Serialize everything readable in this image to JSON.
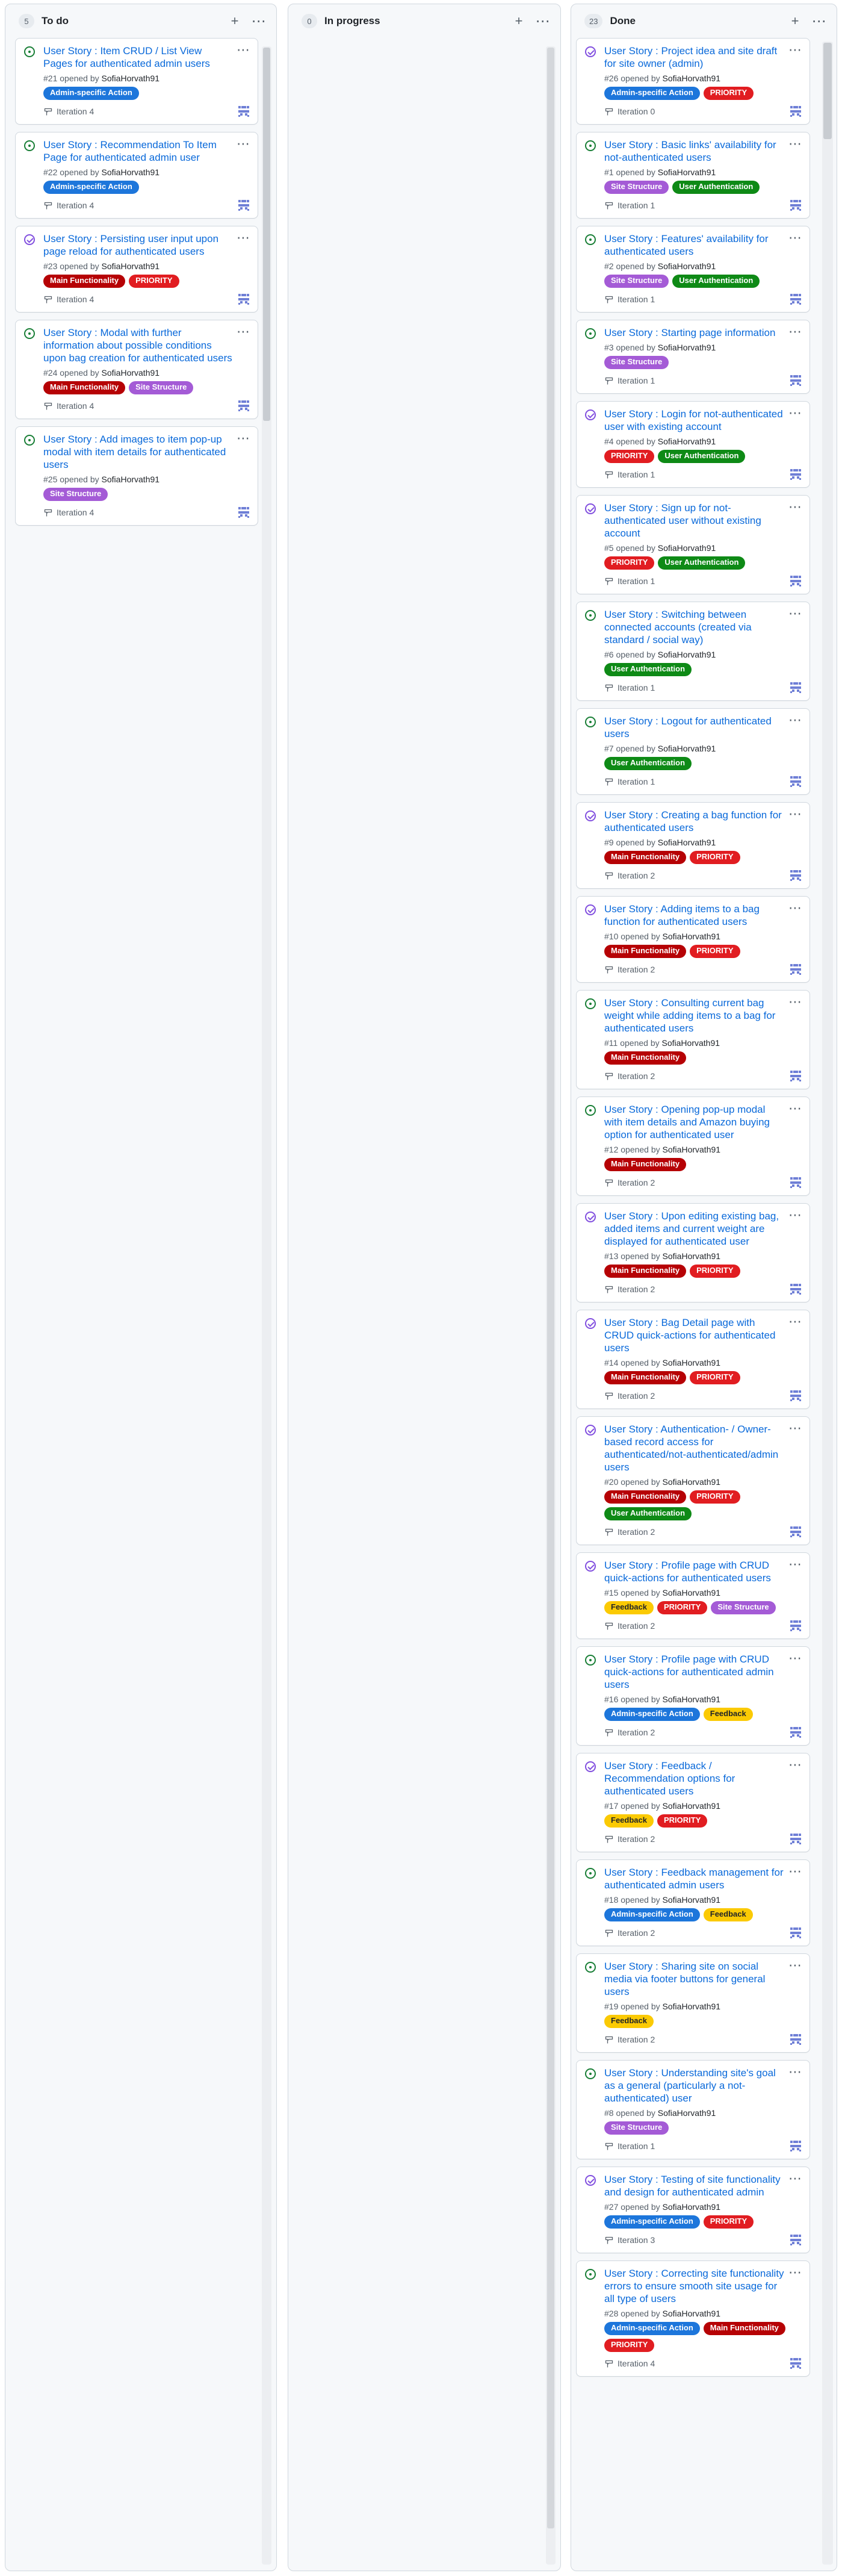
{
  "colors": {
    "open_icon": "#1a7f37",
    "closed_icon": "#8250df",
    "link": "#0969da"
  },
  "label_styles": {
    "Admin-specific Action": {
      "bg": "#1d76db",
      "fg": "#ffffff"
    },
    "PRIORITY": {
      "bg": "#e11d21",
      "fg": "#ffffff"
    },
    "Main Functionality": {
      "bg": "#b60205",
      "fg": "#ffffff"
    },
    "Site Structure": {
      "bg": "#a45bd6",
      "fg": "#ffffff"
    },
    "User Authentication": {
      "bg": "#0e8a16",
      "fg": "#ffffff"
    },
    "Feedback": {
      "bg": "#fbca04",
      "fg": "#1f2328"
    }
  },
  "columns": [
    {
      "id": "todo",
      "count": "5",
      "title": "To do",
      "cards": [
        {
          "status": "open",
          "title": "User Story : Item CRUD / List View Pages for authenticated admin users",
          "number": "#21",
          "opened_by": "opened by",
          "author": "SofiaHorvath91",
          "labels": [
            "Admin-specific Action"
          ],
          "iteration": "Iteration 4"
        },
        {
          "status": "open",
          "title": "User Story : Recommendation To Item Page for authenticated admin user",
          "number": "#22",
          "opened_by": "opened by",
          "author": "SofiaHorvath91",
          "labels": [
            "Admin-specific Action"
          ],
          "iteration": "Iteration 4"
        },
        {
          "status": "closed",
          "title": "User Story : Persisting user input upon page reload for authenticated users",
          "number": "#23",
          "opened_by": "opened by",
          "author": "SofiaHorvath91",
          "labels": [
            "Main Functionality",
            "PRIORITY"
          ],
          "iteration": "Iteration 4"
        },
        {
          "status": "open",
          "title": "User Story : Modal with further information about possible conditions upon bag creation for authenticated users",
          "number": "#24",
          "opened_by": "opened by",
          "author": "SofiaHorvath91",
          "labels": [
            "Main Functionality",
            "Site Structure"
          ],
          "iteration": "Iteration 4"
        },
        {
          "status": "open",
          "title": "User Story : Add images to item pop-up modal with item details for authenticated users",
          "number": "#25",
          "opened_by": "opened by",
          "author": "SofiaHorvath91",
          "labels": [
            "Site Structure"
          ],
          "iteration": "Iteration 4"
        }
      ]
    },
    {
      "id": "progress",
      "count": "0",
      "title": "In progress",
      "cards": []
    },
    {
      "id": "done",
      "count": "23",
      "title": "Done",
      "cards": [
        {
          "status": "closed",
          "title": "User Story : Project idea and site draft for site owner (admin)",
          "number": "#26",
          "opened_by": "opened by",
          "author": "SofiaHorvath91",
          "labels": [
            "Admin-specific Action",
            "PRIORITY"
          ],
          "iteration": "Iteration 0"
        },
        {
          "status": "open",
          "title": "User Story : Basic links' availability for not-authenticated users",
          "number": "#1",
          "opened_by": "opened by",
          "author": "SofiaHorvath91",
          "labels": [
            "Site Structure",
            "User Authentication"
          ],
          "iteration": "Iteration 1"
        },
        {
          "status": "open",
          "title": "User Story : Features' availability for authenticated users",
          "number": "#2",
          "opened_by": "opened by",
          "author": "SofiaHorvath91",
          "labels": [
            "Site Structure",
            "User Authentication"
          ],
          "iteration": "Iteration 1"
        },
        {
          "status": "open",
          "title": "User Story : Starting page information",
          "number": "#3",
          "opened_by": "opened by",
          "author": "SofiaHorvath91",
          "labels": [
            "Site Structure"
          ],
          "iteration": "Iteration 1"
        },
        {
          "status": "closed",
          "title": "User Story : Login for not-authenticated user with existing account",
          "number": "#4",
          "opened_by": "opened by",
          "author": "SofiaHorvath91",
          "labels": [
            "PRIORITY",
            "User Authentication"
          ],
          "iteration": "Iteration 1"
        },
        {
          "status": "closed",
          "title": "User Story : Sign up for not-authenticated user without existing account",
          "number": "#5",
          "opened_by": "opened by",
          "author": "SofiaHorvath91",
          "labels": [
            "PRIORITY",
            "User Authentication"
          ],
          "iteration": "Iteration 1"
        },
        {
          "status": "open",
          "title": "User Story : Switching between connected accounts (created via standard / social way)",
          "number": "#6",
          "opened_by": "opened by",
          "author": "SofiaHorvath91",
          "labels": [
            "User Authentication"
          ],
          "iteration": "Iteration 1"
        },
        {
          "status": "open",
          "title": "User Story : Logout for authenticated users",
          "number": "#7",
          "opened_by": "opened by",
          "author": "SofiaHorvath91",
          "labels": [
            "User Authentication"
          ],
          "iteration": "Iteration 1"
        },
        {
          "status": "closed",
          "title": "User Story : Creating a bag function for authenticated users",
          "number": "#9",
          "opened_by": "opened by",
          "author": "SofiaHorvath91",
          "labels": [
            "Main Functionality",
            "PRIORITY"
          ],
          "iteration": "Iteration 2"
        },
        {
          "status": "closed",
          "title": "User Story : Adding items to a bag function for authenticated users",
          "number": "#10",
          "opened_by": "opened by",
          "author": "SofiaHorvath91",
          "labels": [
            "Main Functionality",
            "PRIORITY"
          ],
          "iteration": "Iteration 2"
        },
        {
          "status": "open",
          "title": "User Story : Consulting current bag weight while adding items to a bag for authenticated users",
          "number": "#11",
          "opened_by": "opened by",
          "author": "SofiaHorvath91",
          "labels": [
            "Main Functionality"
          ],
          "iteration": "Iteration 2"
        },
        {
          "status": "open",
          "title": "User Story : Opening pop-up modal with item details and Amazon buying option for authenticated user",
          "number": "#12",
          "opened_by": "opened by",
          "author": "SofiaHorvath91",
          "labels": [
            "Main Functionality"
          ],
          "iteration": "Iteration 2"
        },
        {
          "status": "closed",
          "title": "User Story : Upon editing existing bag, added items and current weight are displayed for authenticated user",
          "number": "#13",
          "opened_by": "opened by",
          "author": "SofiaHorvath91",
          "labels": [
            "Main Functionality",
            "PRIORITY"
          ],
          "iteration": "Iteration 2"
        },
        {
          "status": "closed",
          "title": "User Story : Bag Detail page with CRUD quick-actions for authenticated users",
          "number": "#14",
          "opened_by": "opened by",
          "author": "SofiaHorvath91",
          "labels": [
            "Main Functionality",
            "PRIORITY"
          ],
          "iteration": "Iteration 2"
        },
        {
          "status": "closed",
          "title": "User Story : Authentication- / Owner-based record access for authenticated/not-authenticated/admin users",
          "number": "#20",
          "opened_by": "opened by",
          "author": "SofiaHorvath91",
          "labels": [
            "Main Functionality",
            "PRIORITY",
            "User Authentication"
          ],
          "iteration": "Iteration 2"
        },
        {
          "status": "closed",
          "title": "User Story : Profile page with CRUD quick-actions for authenticated users",
          "number": "#15",
          "opened_by": "opened by",
          "author": "SofiaHorvath91",
          "labels": [
            "Feedback",
            "PRIORITY",
            "Site Structure"
          ],
          "iteration": "Iteration 2"
        },
        {
          "status": "open",
          "title": "User Story : Profile page with CRUD quick-actions for authenticated admin users",
          "number": "#16",
          "opened_by": "opened by",
          "author": "SofiaHorvath91",
          "labels": [
            "Admin-specific Action",
            "Feedback"
          ],
          "iteration": "Iteration 2"
        },
        {
          "status": "closed",
          "title": "User Story : Feedback / Recommendation options for authenticated users",
          "number": "#17",
          "opened_by": "opened by",
          "author": "SofiaHorvath91",
          "labels": [
            "Feedback",
            "PRIORITY"
          ],
          "iteration": "Iteration 2"
        },
        {
          "status": "open",
          "title": "User Story : Feedback management for authenticated admin users",
          "number": "#18",
          "opened_by": "opened by",
          "author": "SofiaHorvath91",
          "labels": [
            "Admin-specific Action",
            "Feedback"
          ],
          "iteration": "Iteration 2"
        },
        {
          "status": "open",
          "title": "User Story : Sharing site on social media via footer buttons for general users",
          "number": "#19",
          "opened_by": "opened by",
          "author": "SofiaHorvath91",
          "labels": [
            "Feedback"
          ],
          "iteration": "Iteration 2"
        },
        {
          "status": "open",
          "title": "User Story : Understanding site's goal as a general (particularly a not-authenticated) user",
          "number": "#8",
          "opened_by": "opened by",
          "author": "SofiaHorvath91",
          "labels": [
            "Site Structure"
          ],
          "iteration": "Iteration 1"
        },
        {
          "status": "closed",
          "title": "User Story : Testing of site functionality and design for authenticated admin",
          "number": "#27",
          "opened_by": "opened by",
          "author": "SofiaHorvath91",
          "labels": [
            "Admin-specific Action",
            "PRIORITY"
          ],
          "iteration": "Iteration 3"
        },
        {
          "status": "open",
          "title": "User Story : Correcting site functionality errors to ensure smooth site usage for all type of users",
          "number": "#28",
          "opened_by": "opened by",
          "author": "SofiaHorvath91",
          "labels": [
            "Admin-specific Action",
            "Main Functionality",
            "PRIORITY"
          ],
          "iteration": "Iteration 4"
        }
      ]
    }
  ]
}
